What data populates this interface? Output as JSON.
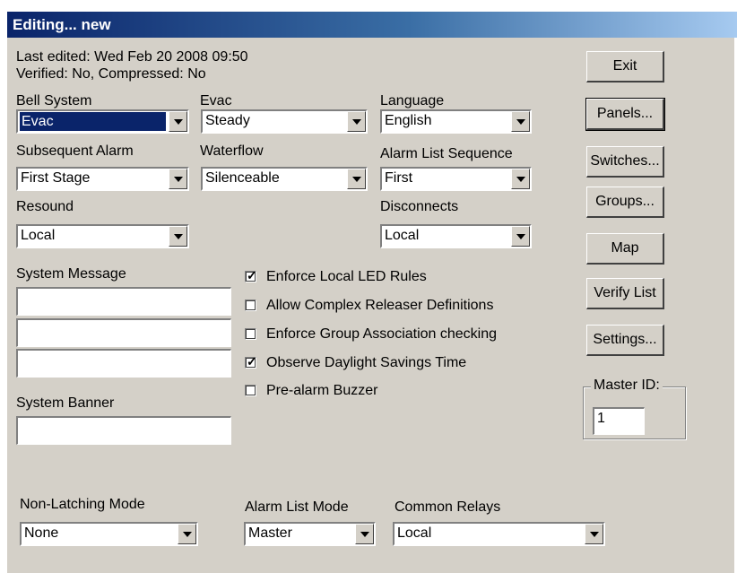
{
  "window": {
    "title": "Editing... new"
  },
  "info": {
    "last_edited": "Last edited: Wed Feb 20 2008 09:50",
    "verified": "Verified: No,   Compressed: No"
  },
  "labels": {
    "bell_system": "Bell System",
    "evac": "Evac",
    "language": "Language",
    "subsequent_alarm": "Subsequent Alarm",
    "waterflow": "Waterflow",
    "alarm_list_sequence": "Alarm List Sequence",
    "resound": "Resound",
    "disconnects": "Disconnects",
    "system_message": "System Message",
    "system_banner": "System Banner",
    "non_latching_mode": "Non-Latching Mode",
    "alarm_list_mode": "Alarm List Mode",
    "common_relays": "Common Relays"
  },
  "combos": {
    "bell_system": "Evac",
    "evac": "Steady",
    "language": "English",
    "subsequent_alarm": "First Stage",
    "waterflow": "Silenceable",
    "alarm_list_sequence": "First",
    "resound": "Local",
    "disconnects": "Local",
    "non_latching_mode": "None",
    "alarm_list_mode": "Master",
    "common_relays": "Local"
  },
  "checkboxes": [
    {
      "label": "Enforce Local LED Rules",
      "checked": true
    },
    {
      "label": "Allow Complex Releaser Definitions",
      "checked": false
    },
    {
      "label": "Enforce Group Association checking",
      "checked": false
    },
    {
      "label": "Observe Daylight Savings Time",
      "checked": true
    },
    {
      "label": "Pre-alarm Buzzer",
      "checked": false
    }
  ],
  "buttons": {
    "exit": "Exit",
    "panels": "Panels...",
    "switches": "Switches...",
    "groups": "Groups...",
    "map": "Map",
    "verify_list": "Verify List",
    "settings": "Settings..."
  },
  "master_id": {
    "label": "Master ID:",
    "value": "1"
  },
  "text_fields": {
    "system_message_1": "",
    "system_message_2": "",
    "system_message_3": "",
    "system_banner": ""
  },
  "colors": {
    "title_start": "#0a246a",
    "title_end": "#a6caf0",
    "face": "#d4d0c8",
    "selection": "#0a246a"
  },
  "icons": {
    "dropdown": "chevron-down-icon",
    "check": "check-icon"
  }
}
